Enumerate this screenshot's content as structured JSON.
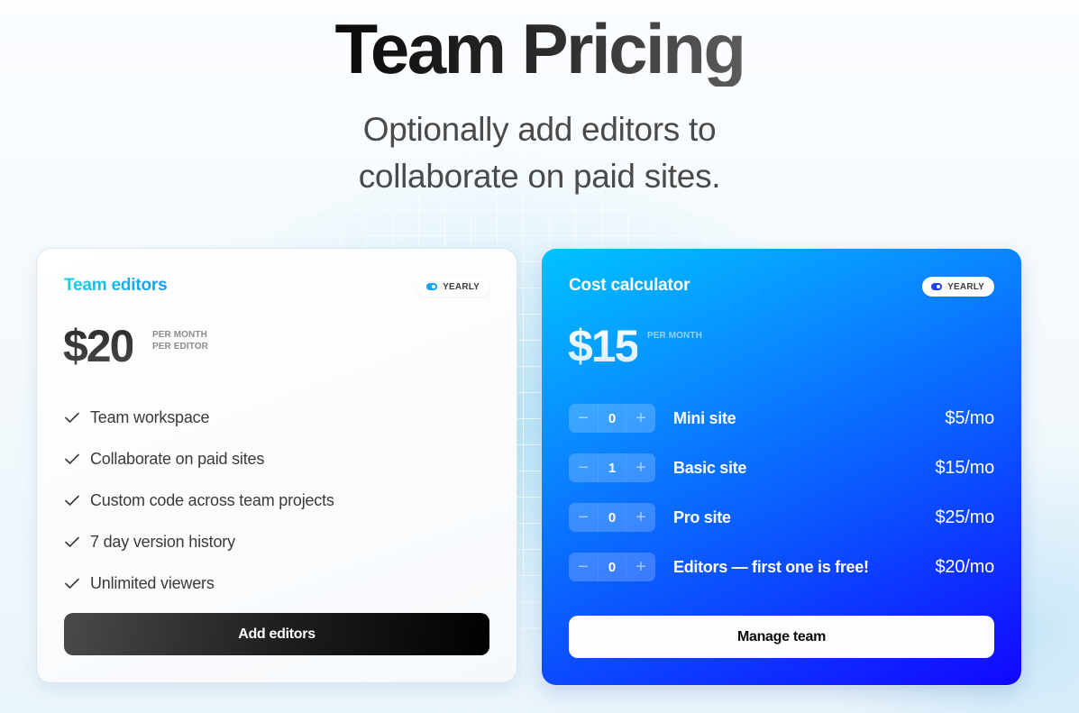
{
  "hero": {
    "title": "Team Pricing",
    "subtitle": "Optionally add editors to collaborate on paid sites."
  },
  "team_editors_card": {
    "title": "Team editors",
    "billing_toggle_label": "YEARLY",
    "price": "$20",
    "price_note_line1": "PER MONTH",
    "price_note_line2": "PER EDITOR",
    "features": [
      "Team workspace",
      "Collaborate on paid sites",
      "Custom code across team projects",
      "7 day version history",
      "Unlimited viewers"
    ],
    "cta_label": "Add editors",
    "accent_color": "#139cf0"
  },
  "cost_calculator_card": {
    "title": "Cost calculator",
    "billing_toggle_label": "YEARLY",
    "price": "$15",
    "price_note": "PER MONTH",
    "items": [
      {
        "quantity": "0",
        "label": "Mini site",
        "price": "$5/mo"
      },
      {
        "quantity": "1",
        "label": "Basic site",
        "price": "$15/mo"
      },
      {
        "quantity": "0",
        "label": "Pro site",
        "price": "$25/mo"
      },
      {
        "quantity": "0",
        "label": "Editors — first one is free!",
        "price": "$20/mo"
      }
    ],
    "decrement_symbol": "−",
    "increment_symbol": "+",
    "cta_label": "Manage team",
    "gradient_start": "#00c3ff",
    "gradient_end": "#1306ff"
  }
}
